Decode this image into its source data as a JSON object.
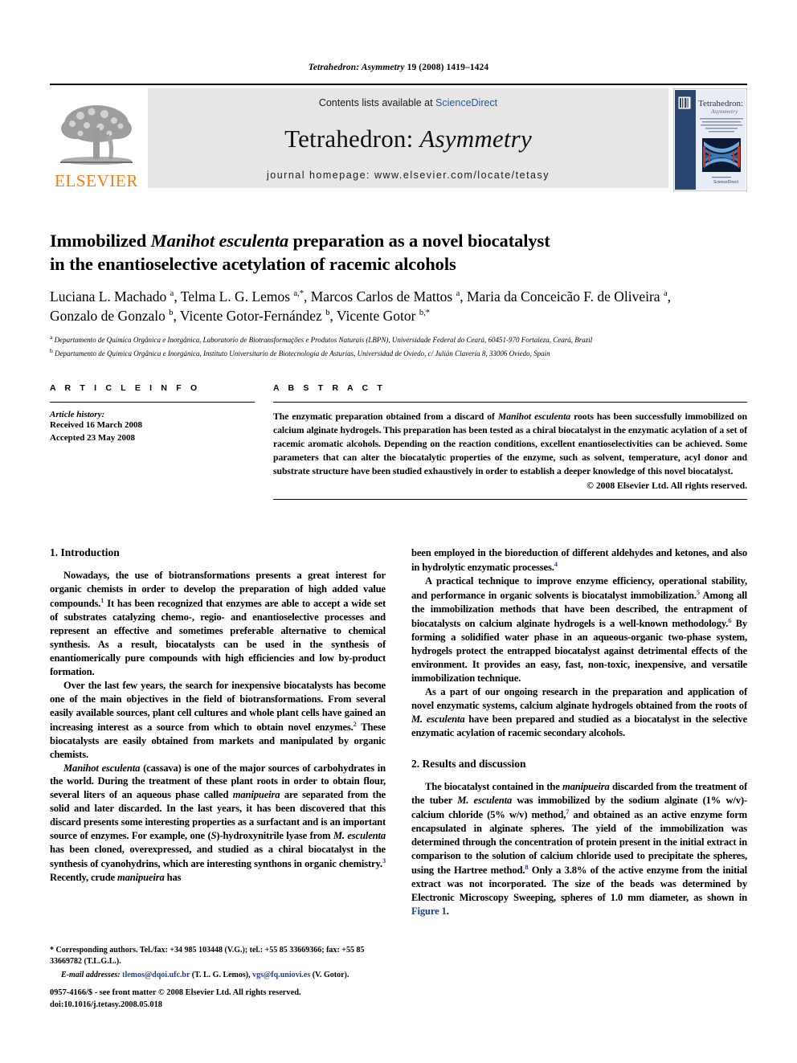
{
  "running_head": {
    "journal": "Tetrahedron: Asymmetry",
    "citation": " 19 (2008) 1419–1424",
    "full": "Tetrahedron: Asymmetry 19 (2008) 1419–1424"
  },
  "masthead": {
    "contents_prefix": "Contents lists available at ",
    "contents_link": "ScienceDirect",
    "journal_title_plain": "Tetrahedron: ",
    "journal_title_italic": "Asymmetry",
    "homepage": "journal homepage: www.elsevier.com/locate/tetasy",
    "publisher": "ELSEVIER",
    "cover_title": "Tetrahedron:",
    "cover_subtitle": "Asymmetry",
    "cover_footer": "ScienceDirect"
  },
  "title": {
    "line1_a": "Immobilized ",
    "line1_it": "Manihot esculenta",
    "line1_b": " preparation as a novel biocatalyst",
    "line2": "in the enantioselective acetylation of racemic alcohols"
  },
  "authors": {
    "line1": "Luciana L. Machado a, Telma L. G. Lemos a,*, Marcos Carlos de Mattos a, Maria da Conceição F. de Oliveira a,",
    "line2": "Gonzalo de Gonzalo b, Vicente Gotor-Fernández b, Vicente Gotor b,*",
    "affil_a": "Departamento de Química Orgânica e Inorgânica, Laboratorio de Biotransformações e Produtos Naturais (LBPN), Universidade Federal do Ceará, 60451-970 Fortaleza, Ceará, Brazil",
    "affil_b": "Departamento de Química Orgânica e Inorgánica, Instituto Universitario de Biotecnología de Asturias, Universidad de Oviedo, c/ Julián Clavería 8, 33006 Oviedo, Spain"
  },
  "article_info": {
    "heading": "A R T I C L E   I N F O",
    "history_label": "Article history:",
    "received": "Received 16 March 2008",
    "accepted": "Accepted 23 May 2008"
  },
  "abstract": {
    "heading": "A B S T R A C T",
    "part1": "The enzymatic preparation obtained from a discard of ",
    "species": "Manihot esculenta",
    "part2": " roots has been successfully immobilized on calcium alginate hydrogels. This preparation has been tested as a chiral biocatalyst in the enzymatic acylation of a set of racemic aromatic alcohols. Depending on the reaction conditions, excellent enantioselectivities can be achieved. Some parameters that can alter the biocatalytic properties of the enzyme, such as solvent, temperature, acyl donor and substrate structure have been studied exhaustively in order to establish a deeper knowledge of this novel biocatalyst.",
    "copyright": "© 2008 Elsevier Ltd. All rights reserved."
  },
  "sections": {
    "intro_heading": "1. Introduction",
    "results_heading": "2. Results and discussion"
  },
  "body": {
    "left": [
      {
        "segments": [
          {
            "t": "Nowadays, the use of biotransformations presents a great interest for organic chemists in order to develop the preparation of high added value compounds."
          },
          {
            "sup": "1"
          },
          {
            "t": " It has been recognized that enzymes are able to accept a wide set of substrates catalyzing chemo-, regio- and enantioselective processes and represent an effective and sometimes preferable alternative to chemical synthesis. As a result, biocatalysts can be used in the synthesis of enantiomerically pure compounds with high efficiencies and low by-product formation."
          }
        ]
      },
      {
        "segments": [
          {
            "t": "Over the last few years, the search for inexpensive biocatalysts has become one of the main objectives in the field of biotransformations. From several easily available sources, plant cell cultures and whole plant cells have gained an increasing interest as a source from which to obtain novel enzymes."
          },
          {
            "sup": "2"
          },
          {
            "t": " These biocatalysts are easily obtained from markets and manipulated by organic chemists."
          }
        ]
      },
      {
        "segments": [
          {
            "it": "Manihot esculenta"
          },
          {
            "t": " (cassava) is one of the major sources of carbohydrates in the world. During the treatment of these plant roots in order to obtain flour, several liters of an aqueous phase called "
          },
          {
            "it": "manipueira"
          },
          {
            "t": " are separated from the solid and later discarded. In the last years, it has been discovered that this discard presents some interesting properties as a surfactant and is an important source of enzymes. For example, one ("
          },
          {
            "it": "S"
          },
          {
            "t": ")-hydroxynitrile lyase from "
          },
          {
            "it": "M. esculenta"
          },
          {
            "t": " has been cloned, overexpressed, and studied as a chiral biocatalyst in the synthesis of cyanohydrins, which are interesting synthons in organic chemistry."
          },
          {
            "sup": "3"
          },
          {
            "t": " Recently, crude "
          },
          {
            "it": "manipueira"
          },
          {
            "t": " has"
          }
        ]
      }
    ],
    "right": [
      {
        "continued": true,
        "segments": [
          {
            "t": "been employed in the bioreduction of different aldehydes and ketones, and also in hydrolytic enzymatic processes."
          },
          {
            "sup": "4"
          }
        ]
      },
      {
        "segments": [
          {
            "t": "A practical technique to improve enzyme efficiency, operational stability, and performance in organic solvents is biocatalyst immobilization."
          },
          {
            "sup": "5"
          },
          {
            "t": " Among all the immobilization methods that have been described, the entrapment of biocatalysts on calcium alginate hydrogels is a well-known methodology."
          },
          {
            "sup": "6"
          },
          {
            "t": " By forming a solidified water phase in an aqueous-organic two-phase system, hydrogels protect the entrapped biocatalyst against detrimental effects of the environment. It provides an easy, fast, non-toxic, inexpensive, and versatile immobilization technique."
          }
        ]
      },
      {
        "segments": [
          {
            "t": "As a part of our ongoing research in the preparation and application of novel enzymatic systems, calcium alginate hydrogels obtained from the roots of "
          },
          {
            "it": "M. esculenta"
          },
          {
            "t": " have been prepared and studied as a biocatalyst in the selective enzymatic acylation of racemic secondary alcohols."
          }
        ]
      },
      {
        "heading": "2. Results and discussion"
      },
      {
        "segments": [
          {
            "t": "The biocatalyst contained in the "
          },
          {
            "it": "manipueira"
          },
          {
            "t": " discarded from the treatment of the tuber "
          },
          {
            "it": "M. esculenta"
          },
          {
            "t": " was immobilized by the sodium alginate (1% w/v)-calcium chloride (5% w/v) method,"
          },
          {
            "sup": "7"
          },
          {
            "t": " and obtained as an active enzyme form encapsulated in alginate spheres. The yield of the immobilization was determined through the concentration of protein present in the initial extract in comparison to the solution of calcium chloride used to precipitate the spheres, using the Hartree method."
          },
          {
            "sup": "8"
          },
          {
            "t": " Only a 3.8% of the active enzyme from the initial extract was not incorporated. The size of the beads was determined by Electronic Microscopy Sweeping, spheres of 1.0 mm diameter, as shown in "
          },
          {
            "xref": "Figure 1"
          },
          {
            "t": "."
          }
        ]
      }
    ]
  },
  "footnotes": {
    "corresponding": "* Corresponding authors. Tel./fax: +34 985 103448 (V.G.); tel.: +55 85 33669366; fax: +55 85 33669782 (T.L.G.L.).",
    "email_label": "E-mail addresses:",
    "email1": "tlemos@dqoi.ufc.br",
    "email1_who": " (T. L. G. Lemos), ",
    "email2": "vgs@fq.uniovi.es",
    "email2_who": " (V. Gotor)."
  },
  "imprint": {
    "line1": "0957-4166/$ - see front matter © 2008 Elsevier Ltd. All rights reserved.",
    "line2": "doi:10.1016/j.tetasy.2008.05.018"
  },
  "colors": {
    "link": "#2956a3",
    "xref": "#1d3f8f",
    "elsevier_orange": "#F07C18",
    "masthead_bg": "#e6e6e6",
    "cover_blue": "#2b4670"
  }
}
